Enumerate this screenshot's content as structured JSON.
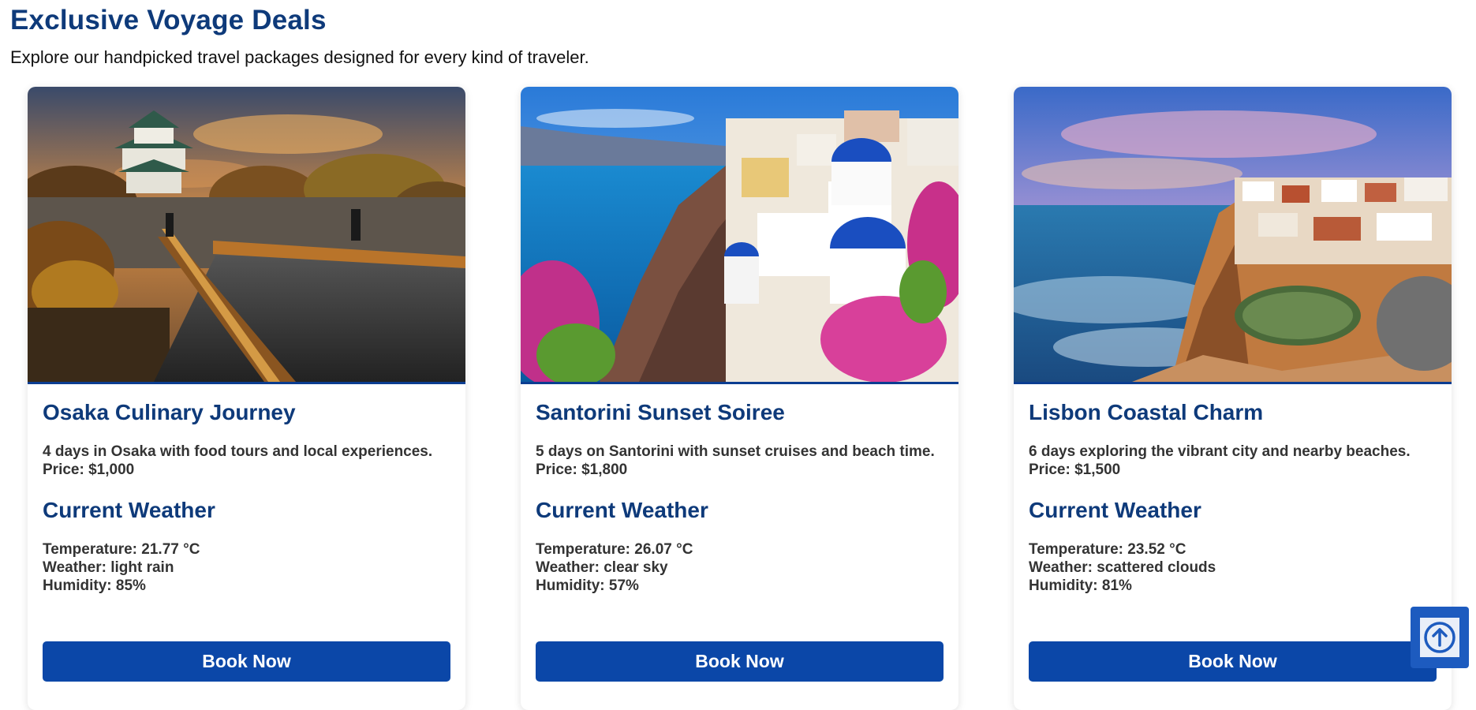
{
  "header": {
    "title": "Exclusive Voyage Deals",
    "subtitle": "Explore our handpicked travel packages designed for every kind of traveler."
  },
  "weather_heading": "Current Weather",
  "cards": [
    {
      "title": "Osaka Culinary Journey",
      "description": "4 days in Osaka with food tours and local experiences.",
      "price": "Price: $1,000",
      "temperature": "Temperature: 21.77 °C",
      "weather": "Weather: light rain",
      "humidity": "Humidity: 85%",
      "button_label": "Book Now",
      "image": "osaka-castle-bridge-photo"
    },
    {
      "title": "Santorini Sunset Soiree",
      "description": "5 days on Santorini with sunset cruises and beach time.",
      "price": "Price: $1,800",
      "temperature": "Temperature: 26.07 °C",
      "weather": "Weather: clear sky",
      "humidity": "Humidity: 57%",
      "button_label": "Book Now",
      "image": "santorini-blue-domes-photo"
    },
    {
      "title": "Lisbon Coastal Charm",
      "description": "6 days exploring the vibrant city and nearby beaches.",
      "price": "Price: $1,500",
      "temperature": "Temperature: 23.52 °C",
      "weather": "Weather: scattered clouds",
      "humidity": "Humidity: 81%",
      "button_label": "Book Now",
      "image": "lisbon-coastal-cliffs-photo"
    }
  ],
  "scroll_top": {
    "icon": "arrow-up-circle-icon"
  },
  "colors": {
    "title_blue": "#0e3a7a",
    "button_blue": "#0b47a8",
    "scroll_button_blue": "#1d5bbf"
  }
}
